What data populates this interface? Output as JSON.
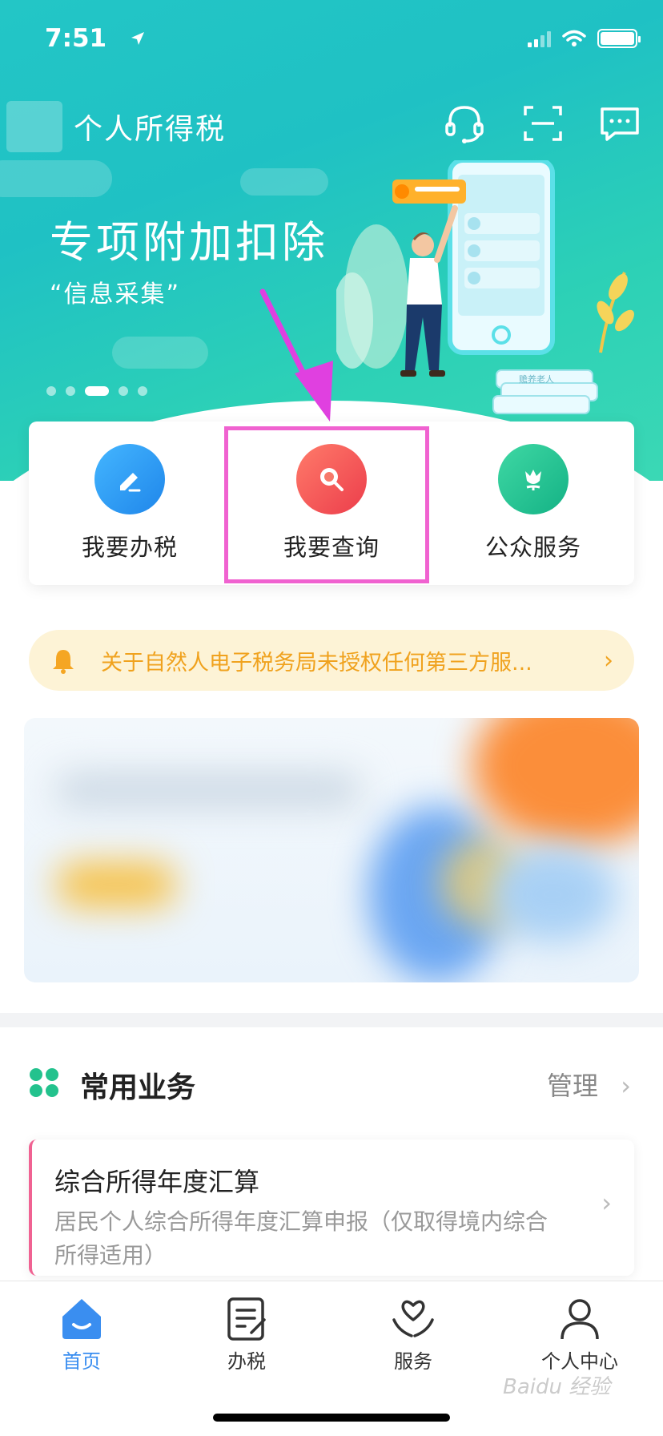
{
  "status_bar": {
    "time": "7:51"
  },
  "app": {
    "title": "个人所得税"
  },
  "banner": {
    "title": "专项附加扣除",
    "subtitle": "“信息采集”",
    "card_label": "赡养老人"
  },
  "quick_actions": [
    {
      "label": "我要办税",
      "icon": "edit-icon",
      "color": "#2f9bf0"
    },
    {
      "label": "我要查询",
      "icon": "search-icon",
      "color": "#f0544f"
    },
    {
      "label": "公众服务",
      "icon": "tulip-icon",
      "color": "#1fbf8a"
    }
  ],
  "notice": {
    "text": "关于自然人电子税务局未授权任何第三方服...",
    "icon": "bell-icon"
  },
  "common_services": {
    "title": "常用业务",
    "manage": "管理",
    "items": [
      {
        "title": "综合所得年度汇算",
        "desc": "居民个人综合所得年度汇算申报（仅取得境内综合所得适用）"
      }
    ]
  },
  "tabbar": {
    "tabs": [
      {
        "label": "首页",
        "icon": "home-icon",
        "active": true
      },
      {
        "label": "办税",
        "icon": "document-edit-icon",
        "active": false
      },
      {
        "label": "服务",
        "icon": "heart-hands-icon",
        "active": false
      },
      {
        "label": "个人中心",
        "icon": "user-icon",
        "active": false
      }
    ]
  },
  "watermark": "Baidu 经验",
  "colors": {
    "accent": "#3a8ef0",
    "header": "#23c6c6",
    "highlight": "#f062d0",
    "notice": "#f0a21e"
  }
}
